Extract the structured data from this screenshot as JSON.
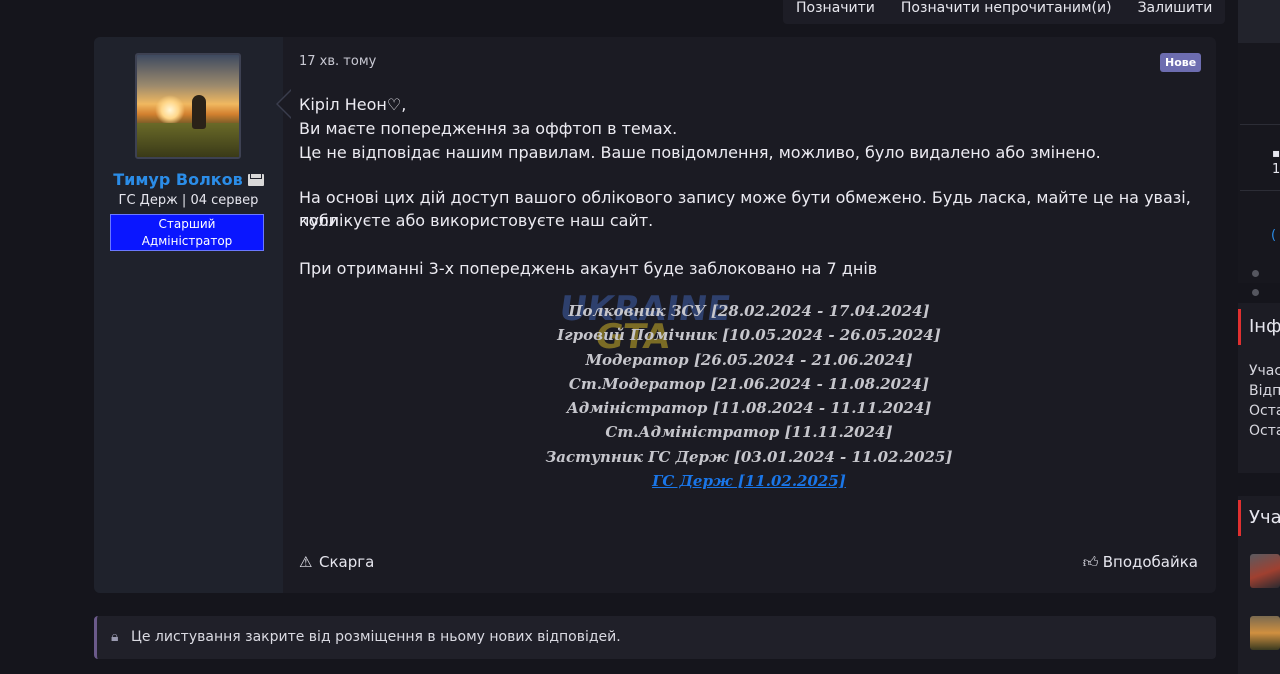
{
  "toolbar": {
    "mark": "Позначити",
    "mark_unread": "Позначити непрочитаним(и)",
    "leave": "Залишити"
  },
  "user": {
    "name": "Тимур Волков",
    "server": "ГС Держ | 04 сервер",
    "role_line1": "Старший",
    "role_line2": "Адміністратор",
    "icons": [
      "avatar",
      "mail-icon"
    ]
  },
  "post": {
    "time": "17 хв. тому",
    "badge": "Нове",
    "lines": [
      "Кіріл Неон♡,",
      "Ви маєте попередження за оффтоп в темах.",
      "Це не відповідає нашим правилам. Ваше повідомлення, можливо, було видалено або змінено.",
      "На основі цих дій доступ вашого облікового запису може бути обмежено. Будь ласка, майте це на увазі, коли",
      "публікуєте або використовуєте наш сайт.",
      "При отриманні 3-х попереджень акаунт буде заблоковано на 7 днів"
    ],
    "career": [
      "Полковник ЗСУ [28.02.2024 - 17.04.2024]",
      "Ігровий Помічник [10.05.2024 - 26.05.2024]",
      "Модератор [26.05.2024 - 21.06.2024]",
      "Ст.Модератор [21.06.2024 - 11.08.2024]",
      "Адміністратор [11.08.2024 - 11.11.2024]",
      "Ст.Адміністратор [11.11.2024]",
      "Заступник ГС Держ [03.01.2024 - 11.02.2025]",
      "ГС Держ [11.02.2025]"
    ],
    "watermark_top": "UKRAINE",
    "watermark_bottom": "GTA",
    "report": "Скарга",
    "like": "Вподобайка"
  },
  "closed_notice": "Це листування закрите від розміщення в ньому нових відповідей.",
  "sidebar": {
    "stat": "1",
    "link": "(",
    "panel1_title": "Інф",
    "panel1_rows": [
      "Учас",
      "Відп",
      "Оста",
      "Оста"
    ],
    "panel2_title": "Уча"
  },
  "colors": {
    "background": "#15151c",
    "post_bg": "#1b1b23",
    "username": "#2b8de8",
    "role_badge": "#0a16ff",
    "badge_new": "#6d6db0",
    "accent_red": "#e03030",
    "career_current": "#1a76e8"
  }
}
